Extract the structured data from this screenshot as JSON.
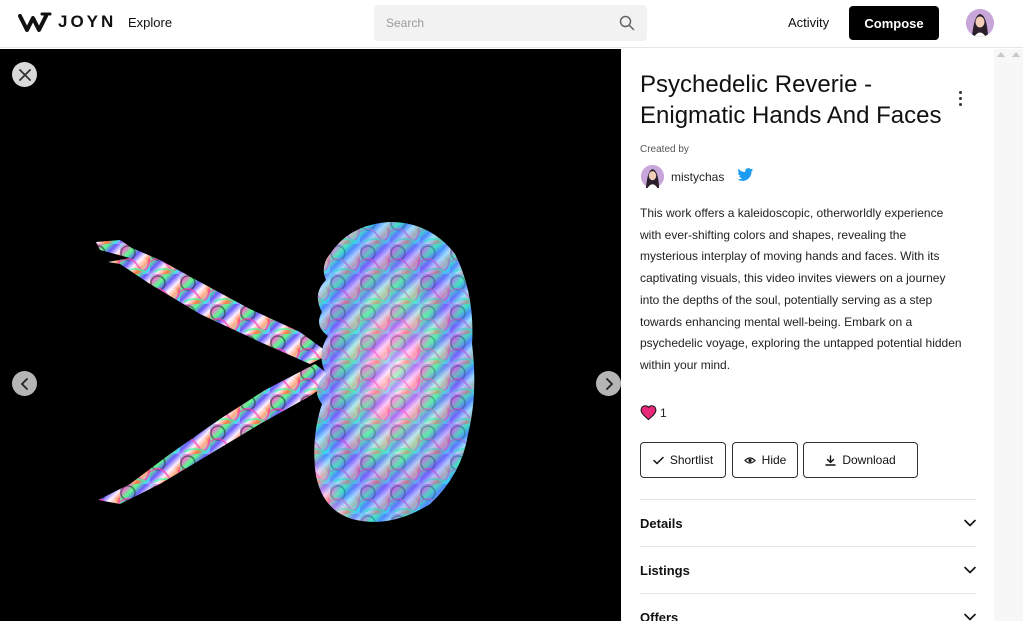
{
  "header": {
    "logo_text": "JOYN",
    "nav_explore": "Explore",
    "search_placeholder": "Search",
    "activity": "Activity",
    "compose": "Compose"
  },
  "artwork": {
    "title": "Psychedelic Reverie - Enigmatic Hands And Faces",
    "created_by_label": "Created by",
    "creator_name": "mistychas",
    "description": "This work offers a kaleidoscopic, otherworldly experience with ever-shifting colors and shapes, revealing the mysterious interplay of moving hands and faces. With its captivating visuals, this video invites viewers on a journey into the depths of the soul, potentially serving as a step towards enhancing mental well-being. Embark on a psychedelic voyage, exploring the untapped potential hidden within your mind.",
    "likes": "1"
  },
  "actions": {
    "shortlist": "Shortlist",
    "hide": "Hide",
    "download": "Download"
  },
  "accordion": {
    "details": "Details",
    "listings": "Listings",
    "offers": "Offers"
  },
  "colors": {
    "accent_heart": "#e8297a",
    "twitter": "#1d9bf0",
    "compose_bg": "#000000"
  },
  "icons": [
    "joyn-logo-icon",
    "search-icon",
    "close-icon",
    "chevron-left-icon",
    "chevron-right-icon",
    "kebab-menu-icon",
    "twitter-icon",
    "heart-icon",
    "check-icon",
    "eye-icon",
    "download-icon",
    "chevron-down-icon"
  ]
}
